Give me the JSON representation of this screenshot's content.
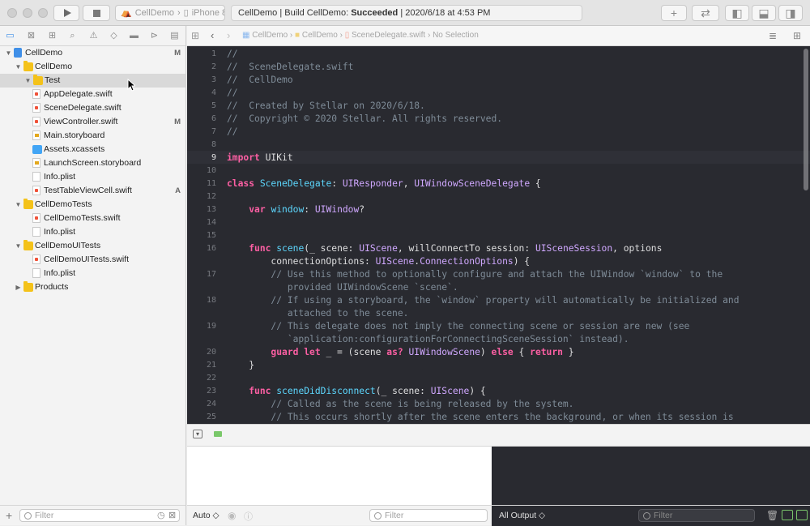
{
  "toolbar": {
    "scheme_project": "CellDemo",
    "scheme_device": "iPhone 8",
    "activity_prefix": "CellDemo | Build CellDemo:",
    "activity_status": "Succeeded",
    "activity_time": "| 2020/6/18 at 4:53 PM",
    "add_label": "+"
  },
  "navigator": {
    "items": [
      {
        "label": "CellDemo",
        "kind": "project",
        "badge": "M"
      },
      {
        "label": "CellDemo",
        "kind": "folder",
        "badge": ""
      },
      {
        "label": "Test",
        "kind": "folder",
        "badge": ""
      },
      {
        "label": "AppDelegate.swift",
        "kind": "swift",
        "badge": ""
      },
      {
        "label": "SceneDelegate.swift",
        "kind": "swift",
        "badge": ""
      },
      {
        "label": "ViewController.swift",
        "kind": "swift",
        "badge": "M"
      },
      {
        "label": "Main.storyboard",
        "kind": "storyboard",
        "badge": ""
      },
      {
        "label": "Assets.xcassets",
        "kind": "assets",
        "badge": ""
      },
      {
        "label": "LaunchScreen.storyboard",
        "kind": "storyboard",
        "badge": ""
      },
      {
        "label": "Info.plist",
        "kind": "plist",
        "badge": ""
      },
      {
        "label": "TestTableViewCell.swift",
        "kind": "swift",
        "badge": "A"
      },
      {
        "label": "CellDemoTests",
        "kind": "folder",
        "badge": ""
      },
      {
        "label": "CellDemoTests.swift",
        "kind": "swift",
        "badge": ""
      },
      {
        "label": "Info.plist",
        "kind": "plist",
        "badge": ""
      },
      {
        "label": "CellDemoUITests",
        "kind": "folder",
        "badge": ""
      },
      {
        "label": "CellDemoUITests.swift",
        "kind": "swift",
        "badge": ""
      },
      {
        "label": "Info.plist",
        "kind": "plist",
        "badge": ""
      },
      {
        "label": "Products",
        "kind": "folder",
        "badge": ""
      }
    ],
    "filter_placeholder": "Filter"
  },
  "jumpbar": {
    "crumbs": [
      "CellDemo",
      "CellDemo",
      "SceneDelegate.swift",
      "No Selection"
    ]
  },
  "editor": {
    "current_line": "9",
    "lines": [
      {
        "n": "1",
        "text": "//"
      },
      {
        "n": "2",
        "text": "//  SceneDelegate.swift"
      },
      {
        "n": "3",
        "text": "//  CellDemo"
      },
      {
        "n": "4",
        "text": "//"
      },
      {
        "n": "5",
        "text": "//  Created by Stellar on 2020/6/18."
      },
      {
        "n": "6",
        "text": "//  Copyright © 2020 Stellar. All rights reserved."
      },
      {
        "n": "7",
        "text": "//"
      },
      {
        "n": "8",
        "text": ""
      },
      {
        "n": "9",
        "text": "import UIKit"
      },
      {
        "n": "10",
        "text": ""
      },
      {
        "n": "11",
        "text": "class SceneDelegate: UIResponder, UIWindowSceneDelegate {"
      },
      {
        "n": "12",
        "text": ""
      },
      {
        "n": "13",
        "text": "    var window: UIWindow?"
      },
      {
        "n": "14",
        "text": ""
      },
      {
        "n": "15",
        "text": ""
      },
      {
        "n": "16",
        "text": "    func scene(_ scene: UIScene, willConnectTo session: UISceneSession, options"
      },
      {
        "n": "",
        "text": "        connectionOptions: UIScene.ConnectionOptions) {"
      },
      {
        "n": "17",
        "text": "        // Use this method to optionally configure and attach the UIWindow `window` to the"
      },
      {
        "n": "",
        "text": "           provided UIWindowScene `scene`."
      },
      {
        "n": "18",
        "text": "        // If using a storyboard, the `window` property will automatically be initialized and"
      },
      {
        "n": "",
        "text": "           attached to the scene."
      },
      {
        "n": "19",
        "text": "        // This delegate does not imply the connecting scene or session are new (see"
      },
      {
        "n": "",
        "text": "           `application:configurationForConnectingSceneSession` instead)."
      },
      {
        "n": "20",
        "text": "        guard let _ = (scene as? UIWindowScene) else { return }"
      },
      {
        "n": "21",
        "text": "    }"
      },
      {
        "n": "22",
        "text": ""
      },
      {
        "n": "23",
        "text": "    func sceneDidDisconnect(_ scene: UIScene) {"
      },
      {
        "n": "24",
        "text": "        // Called as the scene is being released by the system."
      },
      {
        "n": "25",
        "text": "        // This occurs shortly after the scene enters the background, or when its session is"
      }
    ]
  },
  "debug": {
    "auto_label": "Auto ◇",
    "var_filter_placeholder": "Filter",
    "output_label": "All Output ◇",
    "console_filter_placeholder": "Filter"
  }
}
